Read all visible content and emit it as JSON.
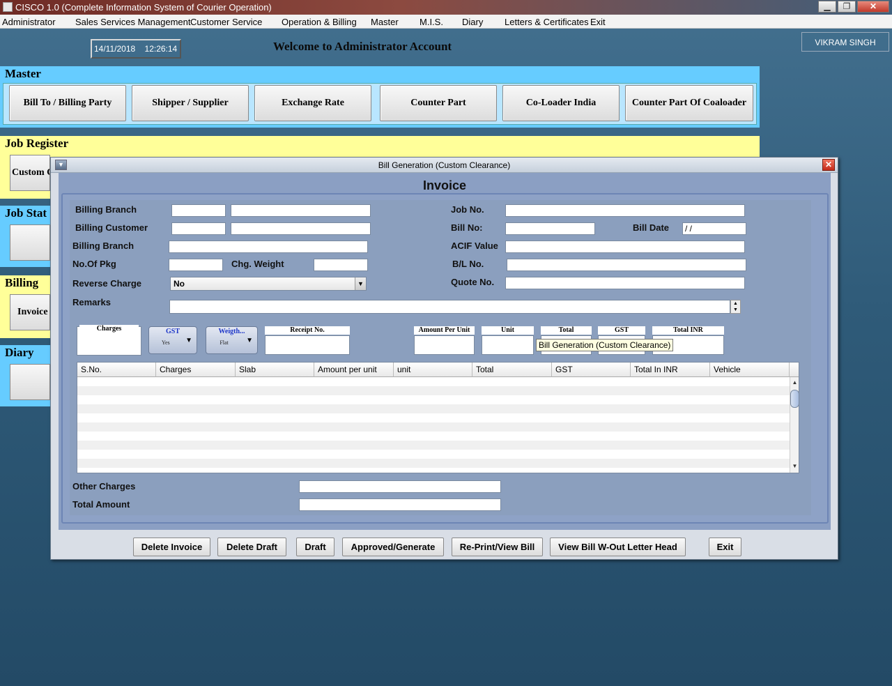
{
  "window": {
    "title": "CISCO 1.0 (Complete Information System of Courier Operation)",
    "minimize": "▁",
    "maximize": "❐",
    "close": "✕"
  },
  "menu": [
    "Administrator",
    "Sales Services Management",
    "Customer Service",
    "Operation & Billing",
    "Master",
    "M.I.S.",
    "Diary",
    "Letters & Certificates",
    "Exit"
  ],
  "header": {
    "date": "14/11/2018",
    "time": "12:26:14",
    "welcome": "Welcome to Administrator Account",
    "user": "VIKRAM SINGH"
  },
  "sections": {
    "master": {
      "title": "Master",
      "buttons": [
        "Bill To / Billing Party",
        "Shipper / Supplier",
        "Exchange Rate",
        "Counter Part",
        "Co-Loader India",
        "Counter Part Of Coaloader"
      ]
    },
    "job_register": {
      "title": "Job Register",
      "visible_button": "Custom C"
    },
    "job_status": {
      "title": "Job Stat"
    },
    "billing": {
      "title": "Billing",
      "visible_button": "Invoice"
    },
    "diary": {
      "title": "Diary"
    }
  },
  "dialog": {
    "title": "Bill Generation (Custom Clearance)",
    "heading": "Invoice",
    "labels": {
      "billing_branch_1": "Billing  Branch",
      "billing_customer": "Billing Customer",
      "billing_branch_2": "Billing Branch",
      "no_of_pkg": "No.Of Pkg",
      "chg_weight": "Chg. Weight",
      "reverse_charge": "Reverse Charge",
      "remarks": "Remarks",
      "job_no": "Job No.",
      "bill_no": "Bill No:",
      "bill_date": "Bill Date",
      "acif_value": "ACIF Value",
      "bl_no": "B/L No.",
      "quote_no": "Quote No.",
      "other_charges": "Other Charges",
      "total_amount": "Total Amount"
    },
    "values": {
      "bill_date": " / /",
      "reverse_charge": "No"
    },
    "entry_heads": {
      "charges": "Charges",
      "gst": "GST",
      "gst_value": "Yes",
      "weight": "Weigth...",
      "weight_value": "Flat",
      "receipt_no": "Receipt No.",
      "amount_per_unit": "Amount Per Unit",
      "unit": "Unit",
      "total": "Total",
      "gst2": "GST",
      "total_inr": "Total INR"
    },
    "tooltip": "Bill Generation (Custom Clearance)",
    "table_columns": [
      "S.No.",
      "Charges",
      "Slab",
      "Amount per unit",
      "unit",
      "Total",
      "GST",
      "Total In INR",
      "Vehicle"
    ],
    "buttons": [
      "Delete Invoice",
      "Delete Draft",
      "Draft",
      "Approved/Generate",
      "Re-Print/View Bill",
      "View Bill W-Out Letter Head",
      "Exit"
    ]
  },
  "colors": {
    "master_bar": "#66ccff",
    "job_bar": "#ffff99",
    "desktop": "#3b6687",
    "dialog_body": "#8b9fc3"
  }
}
